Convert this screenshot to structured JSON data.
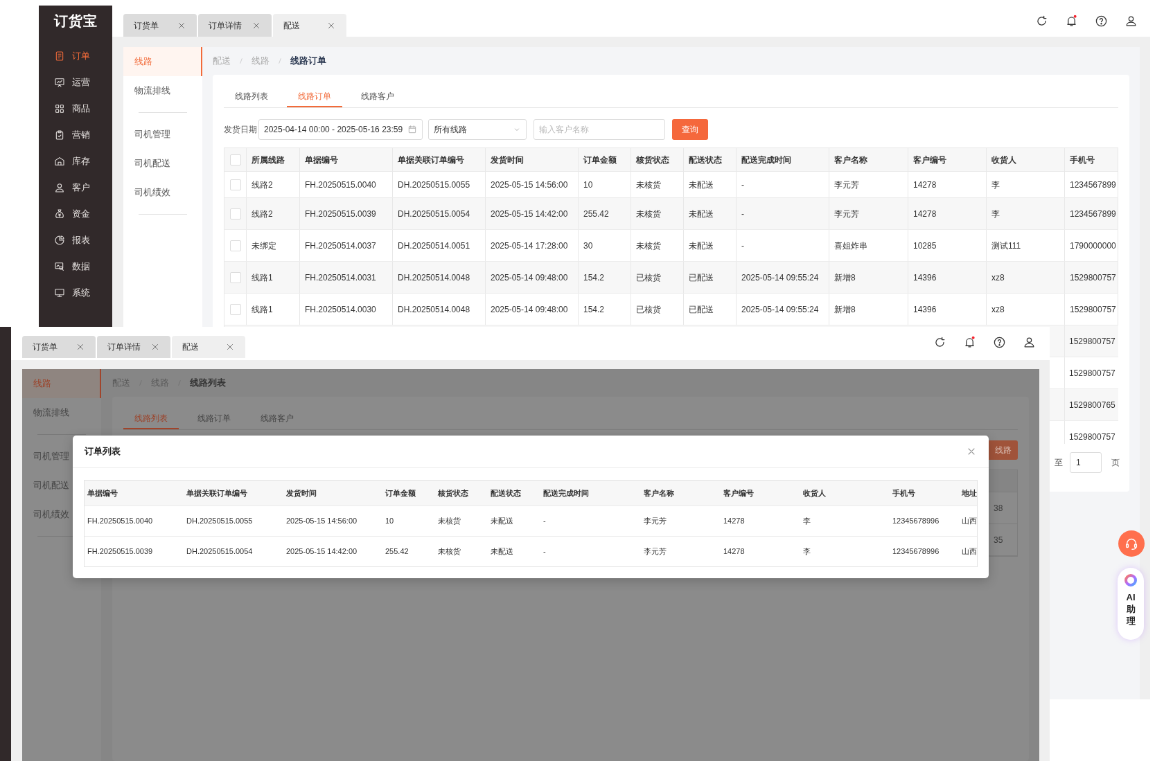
{
  "back_window": {
    "sidebar": {
      "logo": "订货宝",
      "items": [
        {
          "label": "订单",
          "selected": true
        },
        {
          "label": "运营",
          "selected": false
        },
        {
          "label": "商品",
          "selected": false
        },
        {
          "label": "营销",
          "selected": false
        },
        {
          "label": "库存",
          "selected": false
        },
        {
          "label": "客户",
          "selected": false
        },
        {
          "label": "资金",
          "selected": false
        },
        {
          "label": "报表",
          "selected": false
        },
        {
          "label": "数据",
          "selected": false
        },
        {
          "label": "系统",
          "selected": false
        }
      ]
    },
    "tabs": [
      {
        "label": "订货单",
        "selected": false
      },
      {
        "label": "订单详情",
        "selected": false
      },
      {
        "label": "配送",
        "selected": true
      }
    ],
    "subnav": [
      {
        "items": [
          {
            "label": "线路",
            "selected": true
          },
          {
            "label": "物流排线",
            "selected": false
          }
        ]
      },
      {
        "items": [
          {
            "label": "司机管理",
            "selected": false
          },
          {
            "label": "司机配送",
            "selected": false
          },
          {
            "label": "司机绩效",
            "selected": false
          }
        ]
      }
    ],
    "breadcrumb": [
      "配送",
      "线路",
      "线路订单"
    ],
    "view_tabs": [
      {
        "label": "线路列表",
        "selected": false
      },
      {
        "label": "线路订单",
        "selected": true
      },
      {
        "label": "线路客户",
        "selected": false
      }
    ],
    "filters": {
      "date_label": "发货日期",
      "date_range": "2025-04-14 00:00 - 2025-05-16 23:59",
      "route": "所有线路",
      "customer_placeholder": "输入客户名称",
      "query_button": "查询"
    },
    "table": {
      "all_checked": false,
      "columns": [
        "所属线路",
        "单据编号",
        "单据关联订单编号",
        "发货时间",
        "订单金额",
        "核货状态",
        "配送状态",
        "配送完成时间",
        "客户名称",
        "客户编号",
        "收货人",
        "手机号"
      ],
      "rows": [
        {
          "checked": false,
          "cells": [
            "线路2",
            "FH.20250515.0040",
            "DH.20250515.0055",
            "2025-05-15 14:56:00",
            "10",
            "未核货",
            "未配送",
            "-",
            "李元芳",
            "14278",
            "李",
            "1234567899"
          ]
        },
        {
          "checked": false,
          "cells": [
            "线路2",
            "FH.20250515.0039",
            "DH.20250515.0054",
            "2025-05-15 14:42:00",
            "255.42",
            "未核货",
            "未配送",
            "-",
            "李元芳",
            "14278",
            "李",
            "1234567899"
          ]
        },
        {
          "checked": false,
          "cells": [
            "未绑定",
            "FH.20250514.0037",
            "DH.20250514.0051",
            "2025-05-14 17:28:00",
            "30",
            "未核货",
            "未配送",
            "-",
            "喜姐炸串",
            "10285",
            "测试111",
            "1790000000"
          ]
        },
        {
          "checked": false,
          "cells": [
            "线路1",
            "FH.20250514.0031",
            "DH.20250514.0048",
            "2025-05-14 09:48:00",
            "154.2",
            "已核货",
            "已配送",
            "2025-05-14 09:55:24",
            "新增8",
            "14396",
            "xz8",
            "1529800757"
          ]
        },
        {
          "checked": false,
          "cells": [
            "线路1",
            "FH.20250514.0030",
            "DH.20250514.0048",
            "2025-05-14 09:48:00",
            "154.2",
            "已核货",
            "已配送",
            "2025-05-14 09:55:24",
            "新增8",
            "14396",
            "xz8",
            "1529800757"
          ]
        }
      ],
      "phone_only_rows": [
        "1529800757",
        "1529800757",
        "1529800765",
        "1529800757"
      ]
    },
    "pagination": {
      "jump_label": "至",
      "page": "1",
      "page_unit": "页"
    },
    "support": {
      "ai_label": "AI助理"
    }
  },
  "front_window": {
    "tabs": [
      {
        "label": "订货单",
        "selected": false
      },
      {
        "label": "订单详情",
        "selected": false
      },
      {
        "label": "配送",
        "selected": true
      }
    ],
    "subnav": [
      {
        "items": [
          {
            "label": "线路",
            "selected": true
          },
          {
            "label": "物流排线",
            "selected": false
          }
        ]
      },
      {
        "items": [
          {
            "label": "司机管理",
            "selected": false
          },
          {
            "label": "司机配送",
            "selected": false
          },
          {
            "label": "司机绩效",
            "selected": false
          }
        ]
      }
    ],
    "breadcrumb": [
      "配送",
      "线路",
      "线路列表"
    ],
    "view_tabs": [
      {
        "label": "线路列表",
        "selected": true
      },
      {
        "label": "线路订单",
        "selected": false
      },
      {
        "label": "线路客户",
        "selected": false
      }
    ],
    "action_button": "线路",
    "behind_cells": [
      "38",
      "35"
    ],
    "dialog": {
      "title": "订单列表",
      "columns": [
        "单据编号",
        "单据关联订单编号",
        "发货时间",
        "订单金额",
        "核货状态",
        "配送状态",
        "配送完成时间",
        "客户名称",
        "客户编号",
        "收货人",
        "手机号",
        "地址"
      ],
      "rows": [
        [
          "FH.20250515.0040",
          "DH.20250515.0055",
          "2025-05-15 14:56:00",
          "10",
          "未核货",
          "未配送",
          "-",
          "李元芳",
          "14278",
          "李",
          "12345678996",
          "山西"
        ],
        [
          "FH.20250515.0039",
          "DH.20250515.0054",
          "2025-05-15 14:42:00",
          "255.42",
          "未核货",
          "未配送",
          "-",
          "李元芳",
          "14278",
          "李",
          "12345678996",
          "山西"
        ]
      ]
    }
  }
}
